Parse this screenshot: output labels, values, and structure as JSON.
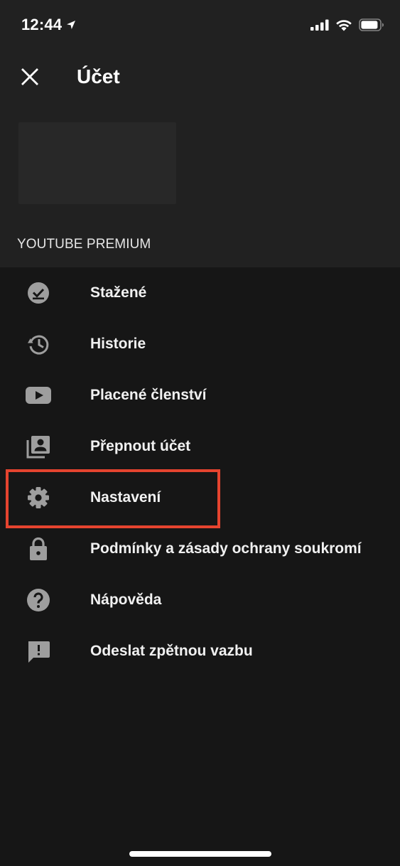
{
  "status_bar": {
    "time": "12:44"
  },
  "header": {
    "title": "Účet"
  },
  "account": {
    "section_label": "YOUTUBE PREMIUM"
  },
  "menu": {
    "items": [
      {
        "label": "Stažené",
        "icon": "downloads-icon"
      },
      {
        "label": "Historie",
        "icon": "history-icon"
      },
      {
        "label": "Placené členství",
        "icon": "paid-memberships-icon"
      },
      {
        "label": "Přepnout účet",
        "icon": "switch-account-icon"
      },
      {
        "label": "Nastavení",
        "icon": "settings-icon"
      },
      {
        "label": "Podmínky a zásady ochrany soukromí",
        "icon": "lock-icon"
      },
      {
        "label": "Nápověda",
        "icon": "help-icon"
      },
      {
        "label": "Odeslat zpětnou vazbu",
        "icon": "feedback-icon"
      }
    ]
  },
  "colors": {
    "background": "#161616",
    "header_background": "#212121",
    "icon_gray": "#9e9e9e",
    "highlight_red": "#e5442f"
  }
}
